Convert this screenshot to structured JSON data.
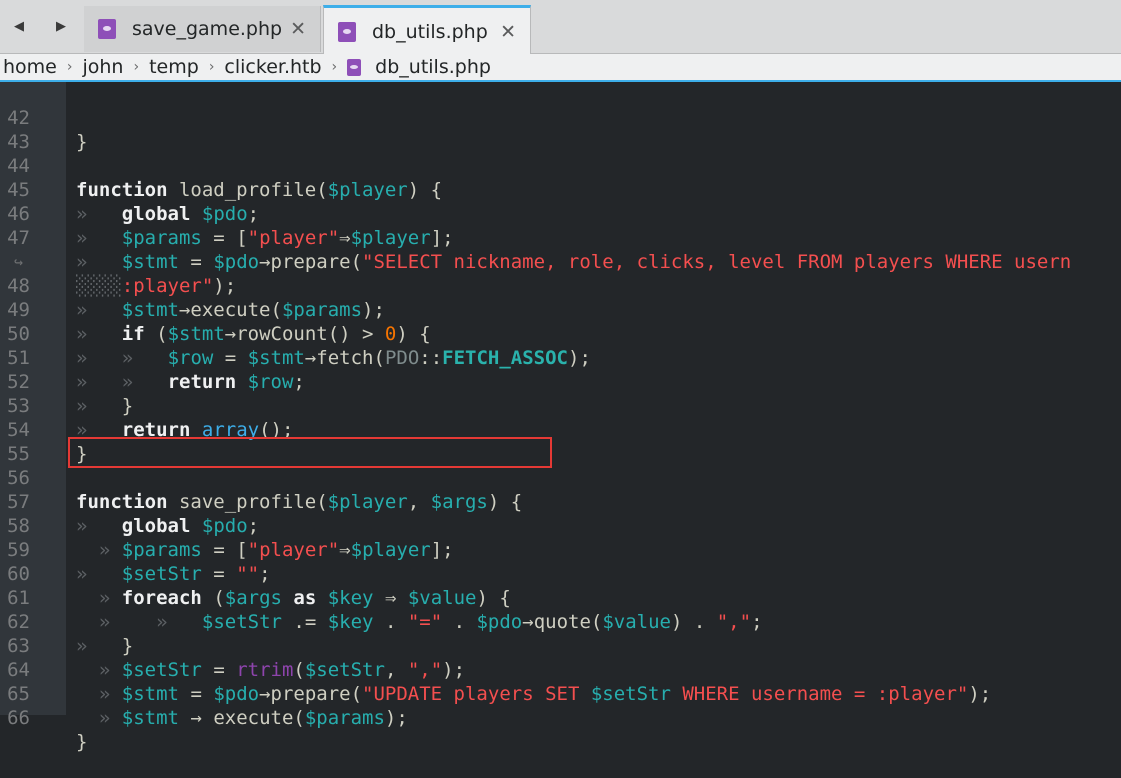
{
  "tabs": [
    {
      "label": "save_game.php",
      "active": false,
      "icon": "php-file-icon",
      "close": "✕"
    },
    {
      "label": "db_utils.php",
      "active": true,
      "icon": "php-file-icon",
      "close": "✕"
    }
  ],
  "nav": {
    "back": "◀",
    "forward": "▶"
  },
  "breadcrumb": [
    "home",
    "john",
    "temp",
    "clicker.htb",
    "db_utils.php"
  ],
  "breadcrumb_sep": "›",
  "colors": {
    "accent": "#3daee9",
    "highlight_box": "#e53935",
    "editor_bg": "#232629"
  },
  "lines": {
    "n42": "42",
    "n43": "43",
    "n44": "44",
    "n45": "45",
    "n46": "46",
    "n47": "47",
    "wrap": "↪",
    "n48": "48",
    "n49": "49",
    "n50": "50",
    "n51": "51",
    "n52": "52",
    "n53": "53",
    "n54": "54",
    "n55": "55",
    "n56": "56",
    "n57": "57",
    "n58": "58",
    "n59": "59",
    "n60": "60",
    "n61": "61",
    "n62": "62",
    "n63": "63",
    "n64": "64",
    "n65": "65",
    "n66": "66"
  },
  "code": {
    "brace_close": "}",
    "kw_function": "function",
    "kw_global": "global",
    "kw_if": "if",
    "kw_return": "return",
    "kw_foreach": "foreach",
    "kw_as": "as",
    "fn_load_profile": " load_profile(",
    "fn_save_profile": " save_profile(",
    "var_player": "$player",
    "var_pdo": "$pdo",
    "var_params": "$params",
    "var_stmt": "$stmt",
    "var_row": "$row",
    "var_args": "$args",
    "var_setStr": "$setStr",
    "var_key": "$key",
    "var_value": "$value",
    "open_sig": ") {",
    "semi": ";",
    "assign": " = ",
    "bracket_open": "[",
    "str_player": "\"player\"",
    "arrow_assoc": "⇒",
    "bracket_close_semi": "];",
    "prepare": "→prepare(",
    "str_select_a": "\"SELECT nickname, role, clicks, level FROM players WHERE usern",
    "str_select_b": ":player\"",
    "close_paren_semi": ");",
    "execute": "→execute(",
    "if_open": " (",
    "rowcount": "→rowCount() > ",
    "zero": "0",
    "paren_brace": ") {",
    "fetch": "→fetch(",
    "cls_pdo": "PDO",
    "dcolon": "::",
    "const_fetch": "FETCH_ASSOC",
    "array_fn": "array",
    "parens_semi": "();",
    "comma_sp": ", ",
    "empty_str": "\"\"",
    "foreach_open": " (",
    "as_kw_sp": " as ",
    "arrow_sp": " ⇒ ",
    "concat_eq": " .= ",
    "dot_sp": " . ",
    "str_eq": "\"=\"",
    "quote_fn": "→quote(",
    "paren_dot": ") . ",
    "str_comma": "\",\"",
    "rtrim": "rtrim",
    "paren_open": "(",
    "str_comma_arg": "\",\"",
    "str_update_a": "\"UPDATE players SET ",
    "str_update_b": " WHERE username = :player\"",
    "stmt_exec_spaced": " → execute(",
    "tab_glyph": "»"
  }
}
